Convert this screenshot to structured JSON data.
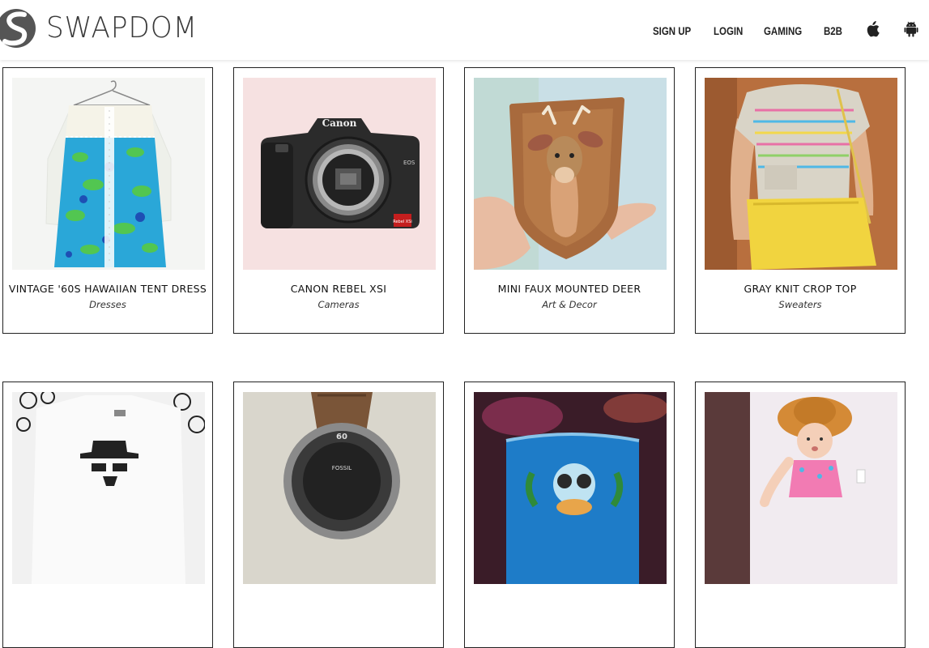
{
  "brand": {
    "name": "SWAPDOM",
    "logo_icon": "swapdom-s-logo"
  },
  "nav": {
    "items": [
      {
        "label": "SIGN UP"
      },
      {
        "label": "LOGIN"
      },
      {
        "label": "GAMING"
      },
      {
        "label": "B2B"
      }
    ],
    "icons": [
      "apple-icon",
      "android-icon"
    ]
  },
  "products": [
    {
      "title": "VINTAGE '60S HAWAIIAN TENT DRESS",
      "category": "Dresses"
    },
    {
      "title": "CANON REBEL XSI",
      "category": "Cameras"
    },
    {
      "title": "MINI FAUX MOUNTED DEER",
      "category": "Art & Decor"
    },
    {
      "title": "GRAY KNIT CROP TOP",
      "category": "Sweaters"
    },
    {
      "title": "",
      "category": ""
    },
    {
      "title": "",
      "category": ""
    },
    {
      "title": "",
      "category": ""
    },
    {
      "title": "",
      "category": ""
    }
  ],
  "photo_text": {
    "camera_brand": "Canon",
    "camera_model_badge": "EOS",
    "camera_red_badge": "Rebel XSi",
    "watch_bezel": "60",
    "watch_dial": "FOSSIL"
  }
}
